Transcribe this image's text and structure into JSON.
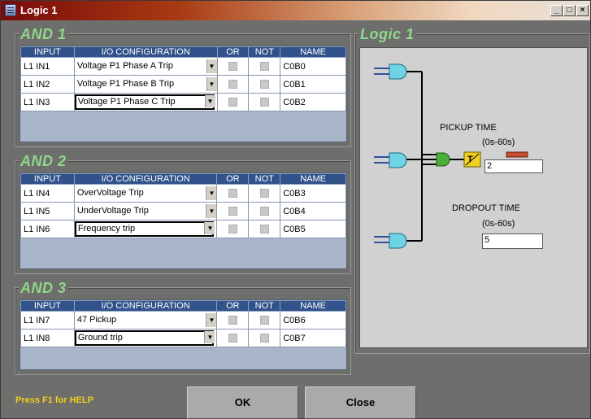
{
  "window": {
    "title": "Logic 1"
  },
  "groups": [
    {
      "title": "AND 1",
      "rows": [
        {
          "input": "L1 IN1",
          "config": "Voltage P1 Phase A Trip",
          "name": "C0B0"
        },
        {
          "input": "L1 IN2",
          "config": "Voltage P1 Phase B Trip",
          "name": "C0B1"
        },
        {
          "input": "L1 IN3",
          "config": "Voltage P1 Phase C Trip",
          "name": "C0B2"
        }
      ]
    },
    {
      "title": "AND 2",
      "rows": [
        {
          "input": "L1 IN4",
          "config": "OverVoltage Trip",
          "name": "C0B3"
        },
        {
          "input": "L1 IN5",
          "config": "UnderVoltage Trip",
          "name": "C0B4"
        },
        {
          "input": "L1 IN6",
          "config": "Frequency trip",
          "name": "C0B5"
        }
      ]
    },
    {
      "title": "AND 3",
      "rows": [
        {
          "input": "L1 IN7",
          "config": "47 Pickup",
          "name": "C0B6"
        },
        {
          "input": "L1 IN8",
          "config": "Ground trip",
          "name": "C0B7"
        }
      ]
    }
  ],
  "columns": {
    "input": "INPUT",
    "config": "I/O CONFIGURATION",
    "or": "OR",
    "not": "NOT",
    "name": "NAME"
  },
  "logic": {
    "title": "Logic 1",
    "pickup_label": "PICKUP TIME",
    "pickup_range": "(0s-60s)",
    "pickup_value": "2",
    "dropout_label": "DROPOUT TIME",
    "dropout_range": "(0s-60s)",
    "dropout_value": "5",
    "timer_symbol": "T"
  },
  "footer": {
    "help": "Press F1 for HELP",
    "ok": "OK",
    "close": "Close"
  },
  "colors": {
    "group_title": "#8fd88a",
    "header": "#31528a",
    "gate": "#6fd3e6",
    "and_out": "#4caf3a",
    "timer": "#f0d020",
    "help": "#f0d01a"
  }
}
